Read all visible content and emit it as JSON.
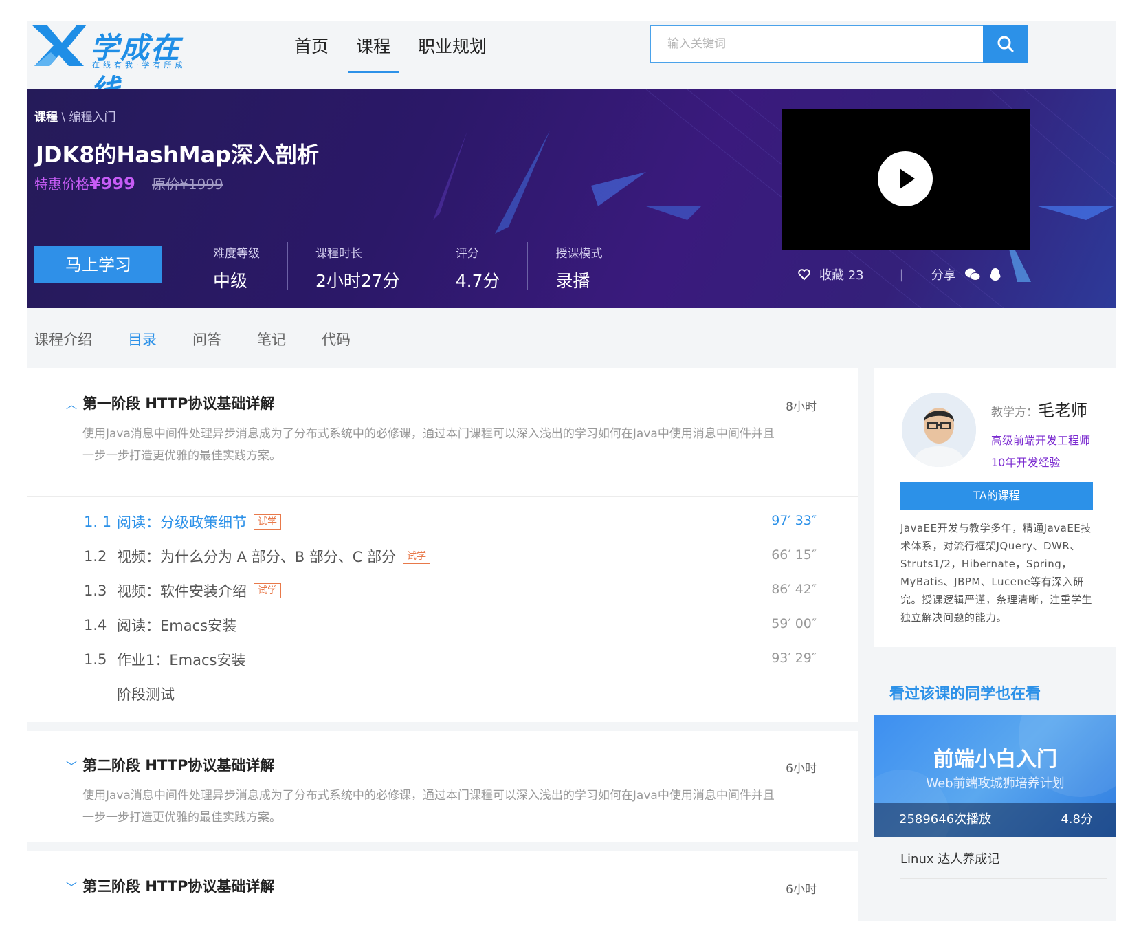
{
  "header": {
    "logo_text": "学成在线",
    "logo_sub": "在线有我·学有所成",
    "nav": [
      "首页",
      "课程",
      "职业规划"
    ],
    "nav_active": "课程",
    "search_placeholder": "输入关键词"
  },
  "banner": {
    "crumb_root": "课程",
    "crumb_sep": "\\",
    "crumb_leaf": "编程入门",
    "title": "JDK8的HashMap深入剖析",
    "price_label": "特惠价格",
    "price_value": "¥999",
    "original_price": "原价¥1999",
    "study_button": "马上学习",
    "stats": [
      {
        "label": "难度等级",
        "value": "中级"
      },
      {
        "label": "课程时长",
        "value": "2小时27分"
      },
      {
        "label": "评分",
        "value": "4.7分"
      },
      {
        "label": "授课模式",
        "value": "录播"
      }
    ],
    "favorite_label": "收藏 23",
    "share_label": "分享",
    "divider": "|"
  },
  "tabs": [
    "课程介绍",
    "目录",
    "问答",
    "笔记",
    "代码"
  ],
  "tab_active": "目录",
  "stages": [
    {
      "title": "第一阶段  HTTP协议基础详解",
      "hours": "8小时",
      "description": "使用Java消息中间件处理异步消息成为了分布式系统中的必修课，通过本门课程可以深入浅出的学习如何在Java中使用消息中间件并且一步一步打造更优雅的最佳实践方案。",
      "lessons": [
        {
          "num": "1. 1",
          "title": "阅读：分级政策细节",
          "trial": "试学",
          "duration": "97′ 33″",
          "active": true
        },
        {
          "num": "1.2",
          "title": "视频：为什么分为 A 部分、B 部分、C 部分",
          "trial": "试学",
          "duration": "66′ 15″"
        },
        {
          "num": "1.3",
          "title": "视频：软件安装介绍",
          "trial": "试学",
          "duration": "86′ 42″"
        },
        {
          "num": "1.4",
          "title": "阅读：Emacs安装",
          "trial": "",
          "duration": "59′ 00″"
        },
        {
          "num": "1.5",
          "title": "作业1：Emacs安装",
          "trial": "",
          "duration": "93′ 29″"
        },
        {
          "num": "",
          "title": "阶段测试",
          "trial": "",
          "duration": ""
        }
      ]
    },
    {
      "title": "第二阶段  HTTP协议基础详解",
      "hours": "6小时",
      "description": "使用Java消息中间件处理异步消息成为了分布式系统中的必修课，通过本门课程可以深入浅出的学习如何在Java中使用消息中间件并且一步一步打造更优雅的最佳实践方案。"
    },
    {
      "title": "第三阶段  HTTP协议基础详解",
      "hours": "6小时"
    }
  ],
  "teacher": {
    "name_label": "教学方：",
    "name": "毛老师",
    "title": "高级前端开发工程师",
    "experience": "10年开发经验",
    "courses_button": "TA的课程",
    "bio": "JavaEE开发与教学多年，精通JavaEE技术体系，对流行框架JQuery、DWR、Struts1/2，Hibernate，Spring，MyBatis、JBPM、Lucene等有深入研究。授课逻辑严谨，条理清晰，注重学生独立解决问题的能力。"
  },
  "also_watched": {
    "heading": "看过该课的同学也在看",
    "promo_title": "前端小白入门",
    "promo_subtitle": "Web前端攻城狮培养计划",
    "plays": "2589646次播放",
    "score": "4.8分",
    "next_item": "Linux 达人养成记"
  },
  "colors": {
    "accent": "#2c91e8",
    "banner_bg": "#2b1868",
    "price": "#c65cf5",
    "trial": "#e8794a",
    "teacher_title": "#7b2bd0"
  }
}
